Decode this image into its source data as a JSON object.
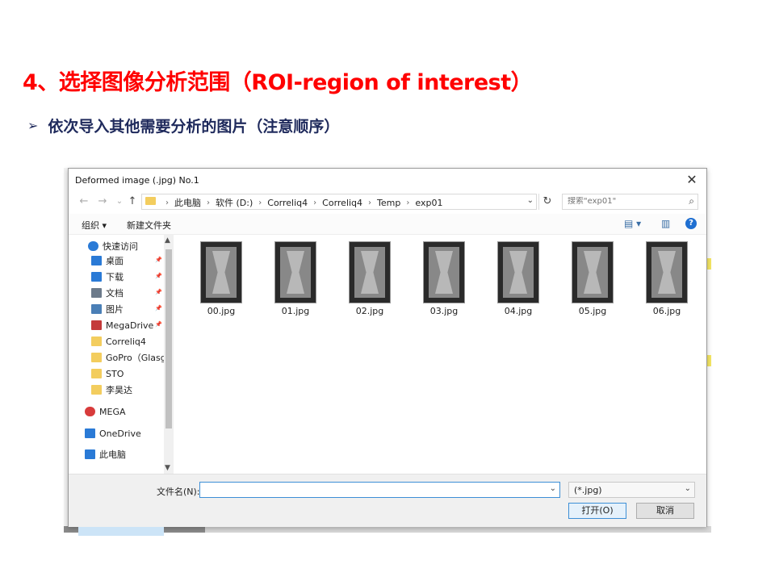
{
  "slide": {
    "title": "4、选择图像分析范围（ROI-region of interest）",
    "bullet_arrow": "➢",
    "bullet_text": "依次导入其他需要分析的图片（注意顺序）"
  },
  "dialog": {
    "title": "Deformed image (.jpg) No.1",
    "close": "✕",
    "nav": {
      "back": "←",
      "forward": "→",
      "recent": "⌄",
      "up": "↑"
    },
    "breadcrumbs": [
      "此电脑",
      "软件 (D:)",
      "Correliq4",
      "Correliq4",
      "Temp",
      "exp01"
    ],
    "breadcrumb_sep": "›",
    "refresh": "↻",
    "search_placeholder": "搜索\"exp01\"",
    "toolbar": {
      "organize": "组织 ▾",
      "new_folder": "新建文件夹",
      "help": "?"
    },
    "nav_items": [
      {
        "label": "快速访问",
        "icon": "star-icon",
        "color": "#2a7ad6",
        "pinned": false
      },
      {
        "label": "桌面",
        "icon": "desktop-icon",
        "color": "#2a7ad6",
        "pinned": true
      },
      {
        "label": "下载",
        "icon": "download-icon",
        "color": "#2a7ad6",
        "pinned": true
      },
      {
        "label": "文档",
        "icon": "document-icon",
        "color": "#6c7a8a",
        "pinned": true
      },
      {
        "label": "图片",
        "icon": "pictures-icon",
        "color": "#4a7fb6",
        "pinned": true
      },
      {
        "label": "MegaDrive",
        "icon": "megadrive-icon",
        "color": "#c43a3a",
        "pinned": true
      },
      {
        "label": "Correliq4",
        "icon": "folder-icon",
        "color": "#f3cd5e",
        "pinned": false
      },
      {
        "label": "GoPro（Glasgo",
        "icon": "folder-icon",
        "color": "#f3cd5e",
        "pinned": false
      },
      {
        "label": "STO",
        "icon": "folder-synced-icon",
        "color": "#f3cd5e",
        "pinned": false
      },
      {
        "label": "李昊达",
        "icon": "folder-icon",
        "color": "#f3cd5e",
        "pinned": false
      },
      {
        "label": "MEGA",
        "icon": "mega-icon",
        "color": "#d83b3b",
        "pinned": false
      },
      {
        "label": "OneDrive",
        "icon": "onedrive-icon",
        "color": "#2a7ad6",
        "pinned": false
      },
      {
        "label": "此电脑",
        "icon": "computer-icon",
        "color": "#2a7ad6",
        "pinned": false
      }
    ],
    "files": [
      "00.jpg",
      "01.jpg",
      "02.jpg",
      "03.jpg",
      "04.jpg",
      "05.jpg",
      "06.jpg"
    ],
    "filename_label": "文件名(N):",
    "filename_value": "",
    "filetype": "(*.jpg)",
    "open_button": "打开(O)",
    "cancel_button": "取消"
  }
}
